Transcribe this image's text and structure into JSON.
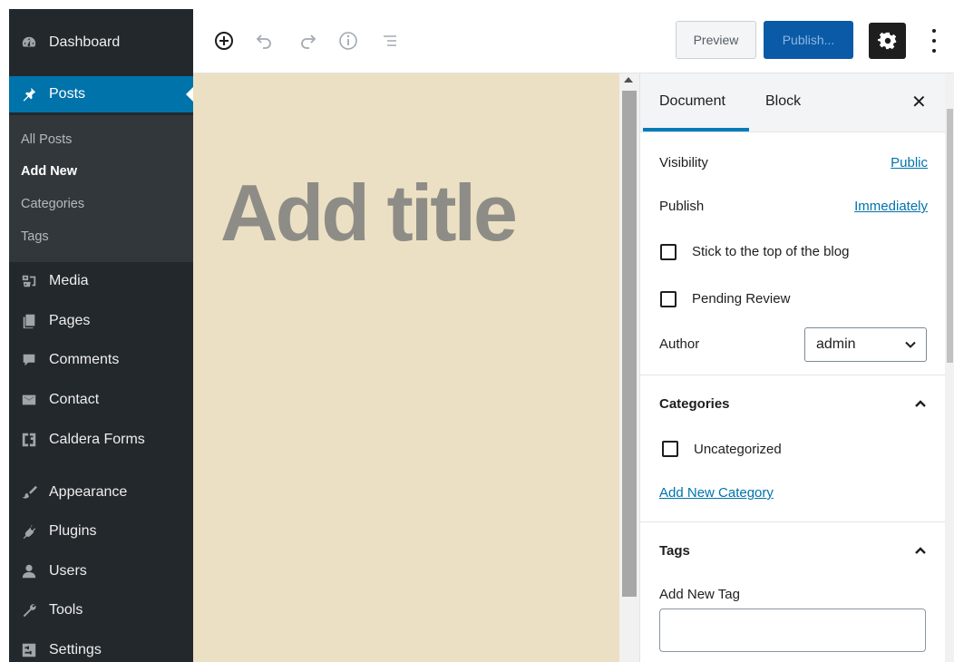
{
  "sidebar": {
    "items": [
      {
        "label": "Dashboard",
        "icon": "dashboard-icon"
      },
      {
        "label": "Posts",
        "icon": "pin-icon"
      },
      {
        "label": "Media",
        "icon": "media-icon"
      },
      {
        "label": "Pages",
        "icon": "pages-icon"
      },
      {
        "label": "Comments",
        "icon": "comment-icon"
      },
      {
        "label": "Contact",
        "icon": "envelope-icon"
      },
      {
        "label": "Caldera Forms",
        "icon": "caldera-icon"
      },
      {
        "label": "Appearance",
        "icon": "brush-icon"
      },
      {
        "label": "Plugins",
        "icon": "plug-icon"
      },
      {
        "label": "Users",
        "icon": "users-icon"
      },
      {
        "label": "Tools",
        "icon": "wrench-icon"
      },
      {
        "label": "Settings",
        "icon": "settings-icon"
      }
    ],
    "submenu": [
      "All Posts",
      "Add New",
      "Categories",
      "Tags"
    ]
  },
  "toolbar": {
    "preview_label": "Preview",
    "publish_label": "Publish...",
    "icons": [
      "add-block-icon",
      "undo-icon",
      "redo-icon",
      "info-icon",
      "outline-icon",
      "gear-icon",
      "more-icon"
    ]
  },
  "editor": {
    "title_placeholder": "Add title"
  },
  "panel": {
    "tabs": [
      "Document",
      "Block"
    ],
    "close": "✕",
    "visibility_label": "Visibility",
    "visibility_value": "Public",
    "publish_label": "Publish",
    "publish_value": "Immediately",
    "sticky_label": "Stick to the top of the blog",
    "pending_label": "Pending Review",
    "author_label": "Author",
    "author_value": "admin",
    "categories_title": "Categories",
    "category_option": "Uncategorized",
    "add_category_label": "Add New Category",
    "tags_title": "Tags",
    "add_tag_label": "Add New Tag",
    "tag_input_value": ""
  },
  "colors": {
    "sidebar_bg": "#23282d",
    "active_blue": "#0073aa",
    "canvas_bg": "#ece0c4",
    "publish_bg": "#0a5aa8"
  }
}
